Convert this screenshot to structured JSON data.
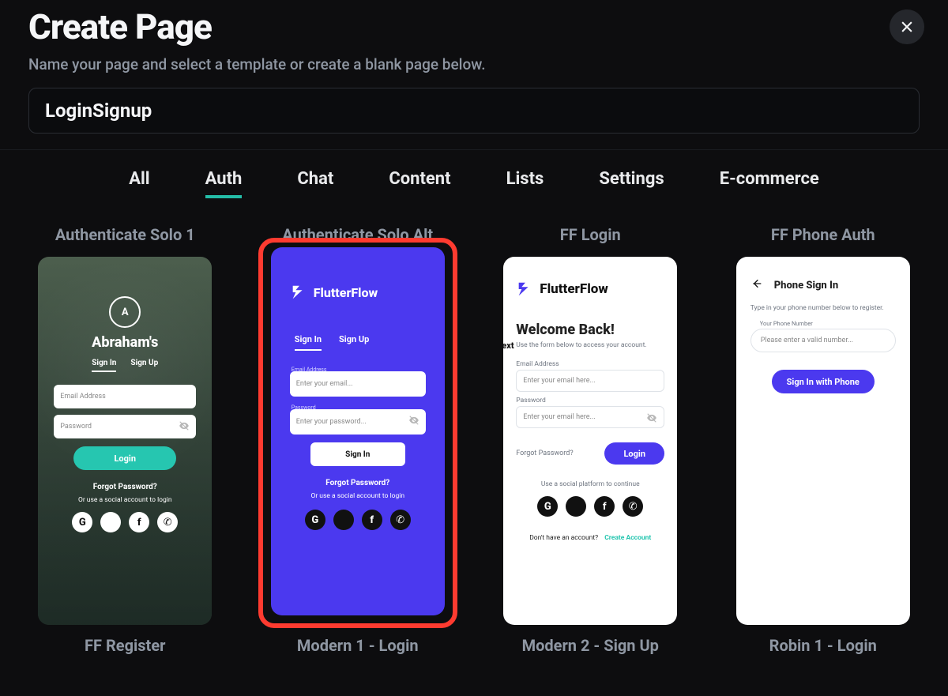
{
  "header": {
    "title": "Create Page",
    "subtitle": "Name your page and select a template or create a blank page below."
  },
  "input": {
    "value": "LoginSignup"
  },
  "tabs": [
    "All",
    "Auth",
    "Chat",
    "Content",
    "Lists",
    "Settings",
    "E-commerce"
  ],
  "active_tab": "Auth",
  "templates": [
    {
      "title": "Authenticate Solo 1",
      "selected": false,
      "phone": {
        "style": "t1",
        "app_name": "Abraham's",
        "logo_letter": "A",
        "tabs": [
          "Sign In",
          "Sign Up"
        ],
        "active_tab": "Sign In",
        "email_ph": "Email Address",
        "password_ph": "Password",
        "login_label": "Login",
        "forgot": "Forgot Password?",
        "or": "Or use a social account to login"
      }
    },
    {
      "title": "Authenticate Solo Alt",
      "selected": true,
      "phone": {
        "style": "t2",
        "brand": "FlutterFlow",
        "tabs": [
          "Sign In",
          "Sign Up"
        ],
        "active_tab": "Sign In",
        "email_label": "Email Address",
        "email_ph": "Enter your email...",
        "password_label": "Password",
        "password_ph": "Enter your password...",
        "signin_label": "Sign In",
        "forgot": "Forgot Password?",
        "or": "Or use a social account to login"
      }
    },
    {
      "title": "FF Login",
      "selected": false,
      "phone": {
        "style": "t3",
        "brand": "FlutterFlow",
        "ext": "ext",
        "welcome": "Welcome Back!",
        "hint": "Use the form below to access your account.",
        "email_label": "Email Address",
        "email_ph": "Enter your email here...",
        "password_label": "Password",
        "password_ph": "Enter your email here...",
        "forgot": "Forgot Password?",
        "login_label": "Login",
        "or": "Use a social platform to continue",
        "no_account": "Don't have an account?",
        "create": "Create Account"
      }
    },
    {
      "title": "FF Phone Auth",
      "selected": false,
      "phone": {
        "style": "t4",
        "heading": "Phone Sign In",
        "hint": "Type in your phone number below to register.",
        "phone_label": "Your Phone Number",
        "phone_ph": "Please enter a valid number...",
        "signin_label": "Sign In with Phone"
      }
    }
  ],
  "next_row_titles": [
    "FF Register",
    "Modern 1 - Login",
    "Modern 2 - Sign Up",
    "Robin 1 - Login"
  ]
}
